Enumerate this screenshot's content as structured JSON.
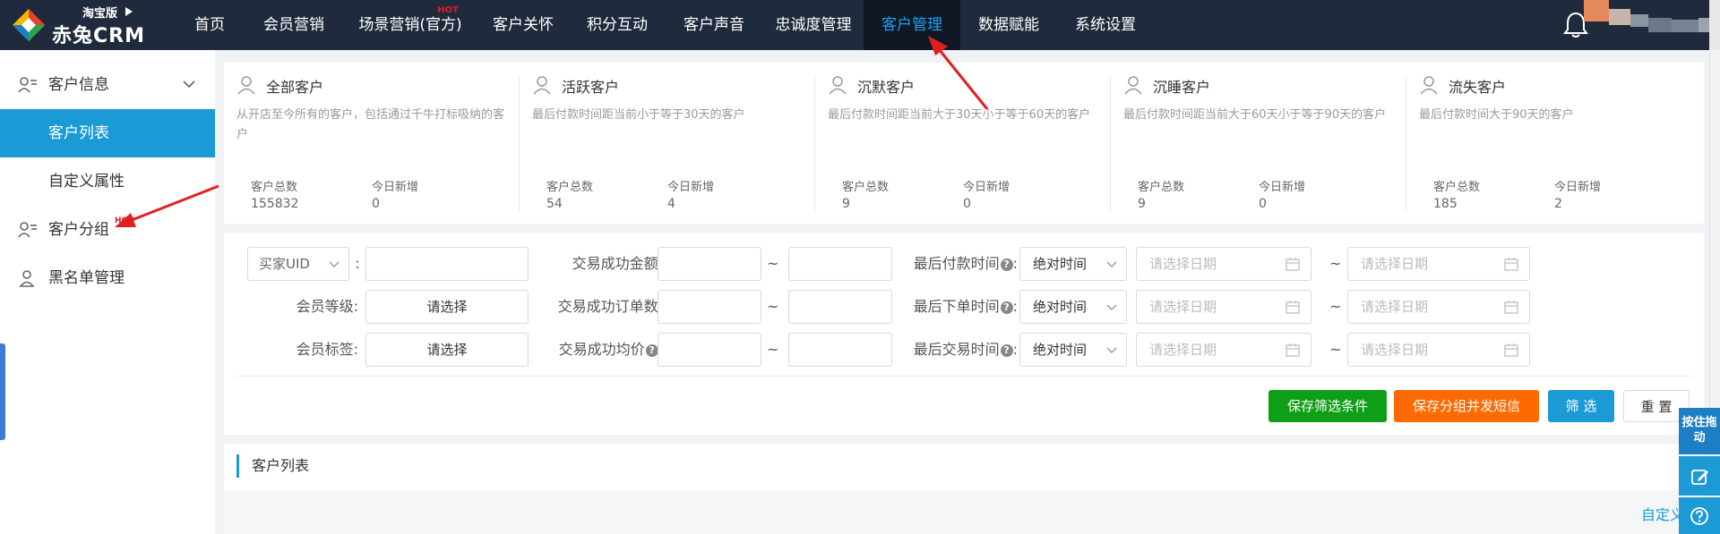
{
  "header": {
    "edition": "淘宝版",
    "brand": "赤兔CRM",
    "nav": [
      {
        "label": "首页"
      },
      {
        "label": "会员营销"
      },
      {
        "label": "场景营销(官方)",
        "badge": "HOT"
      },
      {
        "label": "客户关怀"
      },
      {
        "label": "积分互动"
      },
      {
        "label": "客户声音"
      },
      {
        "label": "忠诚度管理"
      },
      {
        "label": "客户管理",
        "active": true
      },
      {
        "label": "数据赋能"
      },
      {
        "label": "系统设置"
      }
    ]
  },
  "sidebar": {
    "customer_info": "客户信息",
    "customer_list": "客户列表",
    "custom_attr": "自定义属性",
    "customer_group": "客户分组",
    "group_badge": "HOT",
    "blacklist": "黑名单管理"
  },
  "stats": [
    {
      "title": "全部客户",
      "desc": "从开店至今所有的客户，包括通过千牛打标吸纳的客户",
      "total_label": "客户总数",
      "total": "155832",
      "new_label": "今日新增",
      "new": "0"
    },
    {
      "title": "活跃客户",
      "desc": "最后付款时间距当前小于等于30天的客户",
      "total_label": "客户总数",
      "total": "54",
      "new_label": "今日新增",
      "new": "4"
    },
    {
      "title": "沉默客户",
      "desc": "最后付款时间距当前大于30天小于等于60天的客户",
      "total_label": "客户总数",
      "total": "9",
      "new_label": "今日新增",
      "new": "0"
    },
    {
      "title": "沉睡客户",
      "desc": "最后付款时间距当前大于60天小于等于90天的客户",
      "total_label": "客户总数",
      "total": "9",
      "new_label": "今日新增",
      "new": "0"
    },
    {
      "title": "流失客户",
      "desc": "最后付款时间大于90天的客户",
      "total_label": "客户总数",
      "total": "185",
      "new_label": "今日新增",
      "new": "2"
    }
  ],
  "filter": {
    "buyer_select": "买家UID",
    "colon": ":",
    "member_level_label": "会员等级:",
    "member_level_value": "请选择",
    "member_tag_label": "会员标签:",
    "member_tag_value": "请选择",
    "amount_label": "交易成功金额:",
    "orders_label": "交易成功订单数:",
    "avg_label": "交易成功均价",
    "avg_colon": ":",
    "tilde": "~",
    "last_pay_label": "最后付款时间",
    "last_order_label": "最后下单时间",
    "last_trade_label": "最后交易时间",
    "help": "?",
    "time_mode": "绝对时间",
    "date_placeholder": "请选择日期"
  },
  "buttons": {
    "save_filter": "保存筛选条件",
    "save_group_sms": "保存分组并发短信",
    "filter": "筛 选",
    "reset": "重 置"
  },
  "list": {
    "title": "客户列表",
    "custom_columns": "自定义字"
  },
  "tools": {
    "drag": "按住拖动"
  },
  "colors": {
    "topbar": "#1f2a3c",
    "accent": "#1c9ad6",
    "green": "#0f9e17",
    "orange": "#ff6a00",
    "annotation_red": "#e02020"
  }
}
